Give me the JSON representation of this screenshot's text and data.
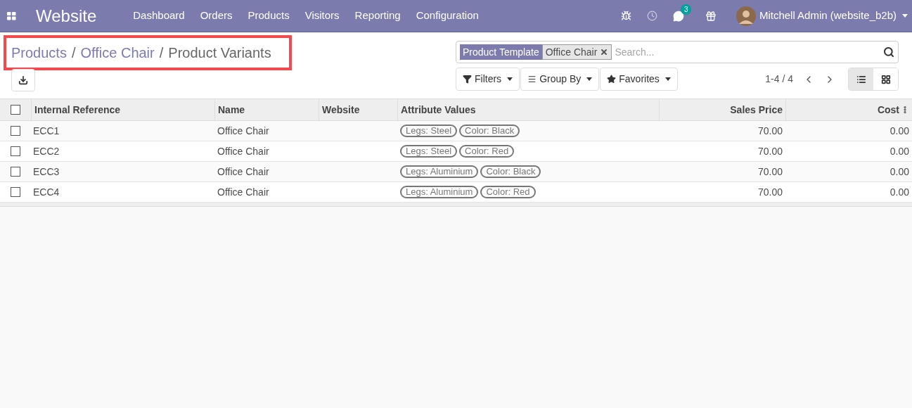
{
  "navbar": {
    "app_name": "Website",
    "menu": [
      "Dashboard",
      "Orders",
      "Products",
      "Visitors",
      "Reporting",
      "Configuration"
    ],
    "messages_count": "3",
    "user": "Mitchell Admin (website_b2b)"
  },
  "breadcrumb_separator": "/",
  "breadcrumbs": [
    {
      "label": "Products",
      "kind": "link"
    },
    {
      "label": "Office Chair",
      "kind": "link"
    },
    {
      "label": "Product Variants",
      "kind": "current"
    }
  ],
  "search": {
    "facet": {
      "label": "Product Template",
      "value": "Office Chair"
    },
    "placeholder": "Search..."
  },
  "filters": [
    "Filters",
    "Group By",
    "Favorites"
  ],
  "pager": "1-4 / 4",
  "views": [
    {
      "kind": "list",
      "selected": true
    },
    {
      "kind": "kanban",
      "selected": false
    }
  ],
  "table": {
    "select_all": {
      "checked": false
    },
    "columns": [
      "Internal Reference",
      "Name",
      "Website",
      "Attribute Values",
      "Sales Price",
      "Cost"
    ],
    "rows": [
      {
        "checked": false,
        "reference": "ECC1",
        "name": "Office Chair",
        "attributes": [
          "Legs: Steel",
          "Color: Black"
        ],
        "price": "70.00",
        "cost": "0.00"
      },
      {
        "checked": false,
        "reference": "ECC2",
        "name": "Office Chair",
        "attributes": [
          "Legs: Steel",
          "Color: Red"
        ],
        "price": "70.00",
        "cost": "0.00"
      },
      {
        "checked": false,
        "reference": "ECC3",
        "name": "Office Chair",
        "attributes": [
          "Legs: Aluminium",
          "Color: Black"
        ],
        "price": "70.00",
        "cost": "0.00"
      },
      {
        "checked": false,
        "reference": "ECC4",
        "name": "Office Chair",
        "attributes": [
          "Legs: Aluminium",
          "Color: Red"
        ],
        "price": "70.00",
        "cost": "0.00"
      }
    ]
  }
}
